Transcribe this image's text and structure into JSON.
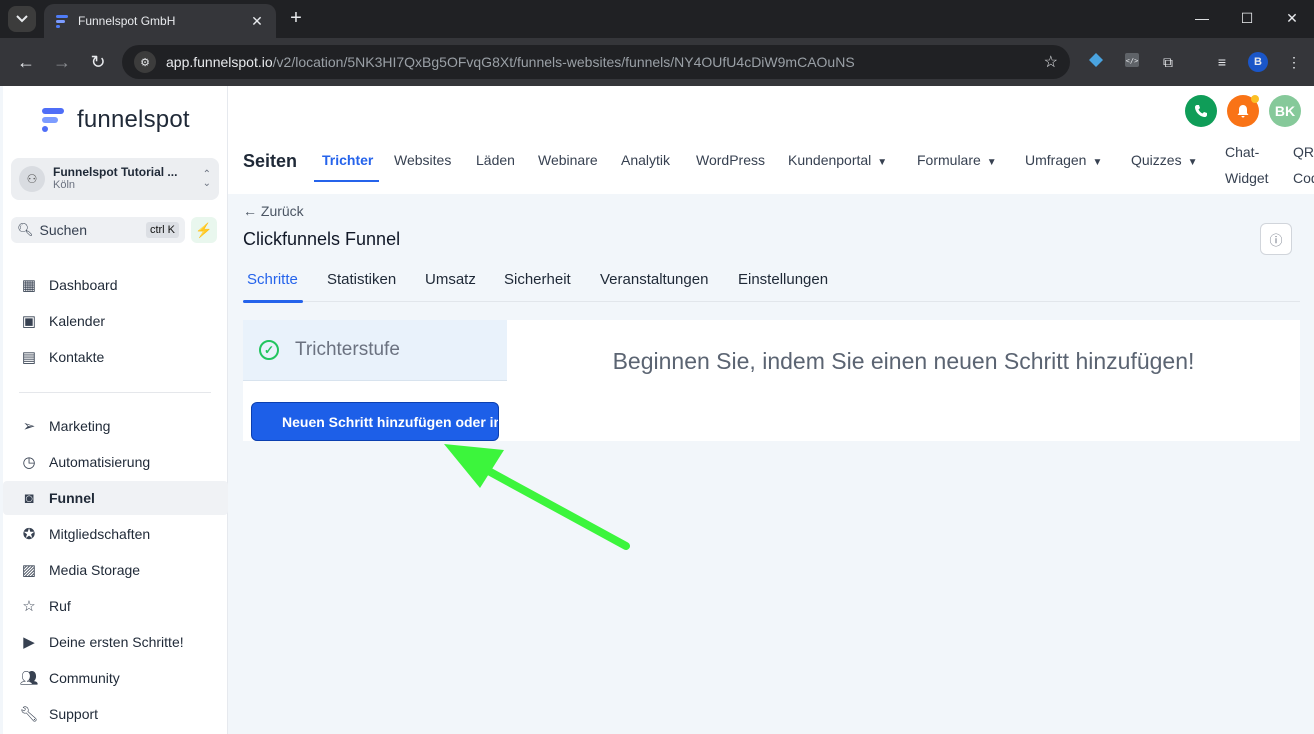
{
  "browser": {
    "tab_title": "Funnelspot GmbH",
    "tab_close": "✕",
    "new_tab": "+",
    "url_host": "app.funnelspot.io",
    "url_path": "/v2/location/5NK3HI7QxBg5OFvqG8Xt/funnels-websites/funnels/NY4OUfU4cDiW9mCAOuNS",
    "profile_initial": "B",
    "window_controls": [
      "—",
      "☐",
      "✕"
    ]
  },
  "sidebar": {
    "logo_text": "funnelspot",
    "location": {
      "name": "Funnelspot Tutorial ...",
      "city": "Köln"
    },
    "search": {
      "label": "Suchen",
      "shortcut": "ctrl K"
    },
    "items_top": [
      {
        "label": "Dashboard",
        "icon": "dashboard-icon"
      },
      {
        "label": "Kalender",
        "icon": "calendar-icon"
      },
      {
        "label": "Kontakte",
        "icon": "contacts-icon"
      }
    ],
    "items_bottom": [
      {
        "label": "Marketing",
        "icon": "send-icon"
      },
      {
        "label": "Automatisierung",
        "icon": "automation-icon"
      },
      {
        "label": "Funnel",
        "icon": "funnel-icon",
        "active": true
      },
      {
        "label": "Mitgliedschaften",
        "icon": "badge-icon"
      },
      {
        "label": "Media Storage",
        "icon": "image-icon"
      },
      {
        "label": "Ruf",
        "icon": "star-icon"
      },
      {
        "label": "Deine ersten Schritte!",
        "icon": "play-icon"
      },
      {
        "label": "Community",
        "icon": "people-icon"
      },
      {
        "label": "Support",
        "icon": "wrench-icon"
      }
    ]
  },
  "header": {
    "avatar_initials": "BK",
    "section_title": "Seiten",
    "tabs": [
      {
        "label": "Trichter",
        "active": true
      },
      {
        "label": "Websites"
      },
      {
        "label": "Läden"
      },
      {
        "label": "Webinare"
      },
      {
        "label": "Analytik"
      },
      {
        "label": "WordPress"
      },
      {
        "label": "Kundenportal",
        "dropdown": true
      },
      {
        "label": "Formulare",
        "dropdown": true
      },
      {
        "label": "Umfragen",
        "dropdown": true
      },
      {
        "label": "Quizzes",
        "dropdown": true
      }
    ],
    "chat_widget": [
      "Chat-",
      "Widget"
    ],
    "qr_code": [
      "QR-",
      "Cod"
    ]
  },
  "content": {
    "back_label": "← Zurück",
    "title": "Clickfunnels Funnel",
    "subtabs": [
      {
        "label": "Schritte",
        "active": true
      },
      {
        "label": "Statistiken"
      },
      {
        "label": "Umsatz"
      },
      {
        "label": "Sicherheit"
      },
      {
        "label": "Veranstaltungen"
      },
      {
        "label": "Einstellungen"
      }
    ],
    "step_label": "Trichterstufe",
    "add_step_button": "Neuen Schritt hinzufügen oder im",
    "empty_message": "Beginnen Sie, indem Sie einen neuen Schritt hinzufügen!"
  },
  "colors": {
    "accent": "#2563eb",
    "button": "#1d5fe8",
    "arrow": "#3cf53c",
    "phone": "#0f9d58",
    "bell": "#f97316",
    "avatar": "#86c99a"
  }
}
